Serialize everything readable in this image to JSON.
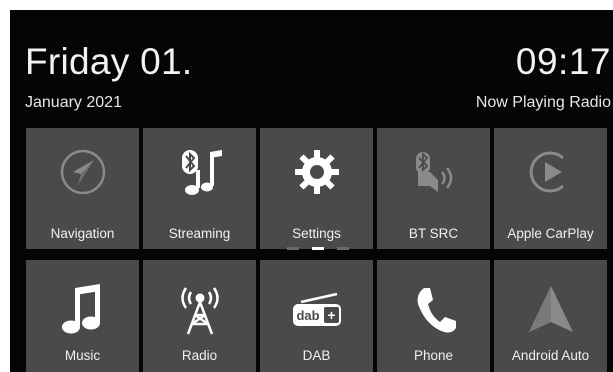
{
  "header": {
    "date_line": "Friday 01.",
    "month_year": "January 2021",
    "time": "09:17",
    "now_playing": "Now Playing Radio"
  },
  "tiles_row1": [
    {
      "label": "Navigation",
      "icon": "navigation-compass-icon"
    },
    {
      "label": "Streaming",
      "icon": "bluetooth-music-icon"
    },
    {
      "label": "Settings",
      "icon": "gear-icon"
    },
    {
      "label": "BT SRC",
      "icon": "bluetooth-speaker-icon"
    },
    {
      "label": "Apple CarPlay",
      "icon": "carplay-play-icon"
    }
  ],
  "tiles_row2": [
    {
      "label": "Music",
      "icon": "music-note-icon"
    },
    {
      "label": "Radio",
      "icon": "radio-tower-icon"
    },
    {
      "label": "DAB",
      "icon": "dab-plus-icon"
    },
    {
      "label": "Phone",
      "icon": "phone-handset-icon"
    },
    {
      "label": "Android Auto",
      "icon": "android-auto-icon"
    }
  ],
  "pager": {
    "pages": 3,
    "active_page": 2
  },
  "colors": {
    "background": "#050505",
    "tile": "#4a4a4a",
    "icon_active": "#ffffff",
    "icon_dimmed": "#8a8a8a",
    "text": "#f0f0f0"
  }
}
